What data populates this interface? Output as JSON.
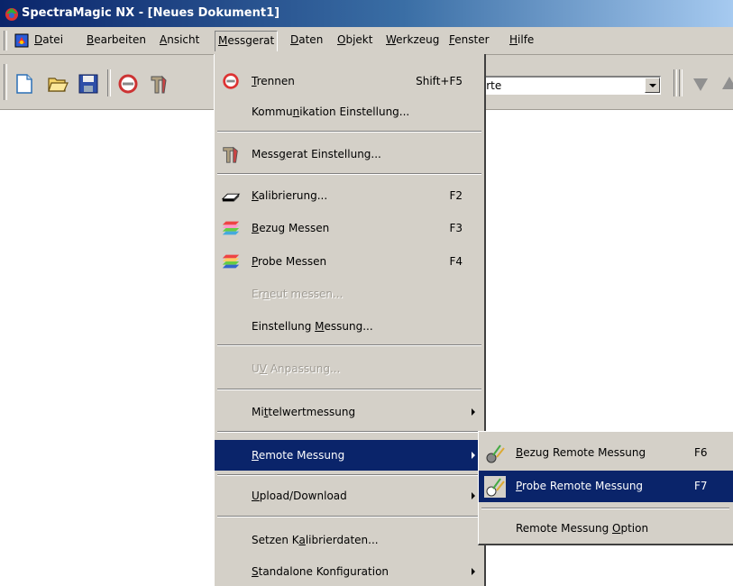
{
  "window": {
    "title": "SpectraMagic NX - [Neues Dokument1]"
  },
  "menubar": {
    "items": [
      {
        "pre": "",
        "key": "D",
        "post": "atei"
      },
      {
        "pre": "",
        "key": "B",
        "post": "earbeiten"
      },
      {
        "pre": "",
        "key": "A",
        "post": "nsicht"
      },
      {
        "pre": "",
        "key": "M",
        "post": "essgerat"
      },
      {
        "pre": "",
        "key": "D",
        "post": "aten"
      },
      {
        "pre": "",
        "key": "O",
        "post": "bjekt"
      },
      {
        "pre": "",
        "key": "W",
        "post": "erkzeug"
      },
      {
        "pre": "",
        "key": "F",
        "post": "enster"
      },
      {
        "pre": "",
        "key": "H",
        "post": "ilfe"
      }
    ]
  },
  "toolbar": {
    "combo_value": "werte",
    "icons": [
      "new-document-icon",
      "open-folder-icon",
      "save-disk-icon",
      "disconnect-icon",
      "instrument-settings-icon"
    ]
  },
  "messgerat_menu": {
    "items": [
      {
        "pre": "",
        "key": "T",
        "post": "rennen",
        "shortcut": "Shift+F5",
        "icon": "disconnect-icon",
        "enabled": true
      },
      {
        "pre": "Kommu",
        "key": "n",
        "post": "ikation Einstellung...",
        "shortcut": "",
        "enabled": true
      },
      {
        "pre": "Mess",
        "key": "g",
        "post": "erat Einstellung...",
        "shortcut": "",
        "icon": "instrument-settings-icon",
        "enabled": true
      },
      {
        "pre": "",
        "key": "K",
        "post": "alibrierung...",
        "shortcut": "F2",
        "icon": "calibration-plate-icon",
        "enabled": true
      },
      {
        "pre": "",
        "key": "B",
        "post": "ezug Messen",
        "shortcut": "F3",
        "icon": "target-measure-icon",
        "enabled": true
      },
      {
        "pre": "",
        "key": "P",
        "post": "robe Messen",
        "shortcut": "F4",
        "icon": "sample-measure-icon",
        "enabled": true
      },
      {
        "pre": "Er",
        "key": "n",
        "post": "eut messen...",
        "shortcut": "",
        "enabled": false
      },
      {
        "pre": "Einstellung ",
        "key": "M",
        "post": "essung...",
        "shortcut": "",
        "enabled": true
      },
      {
        "pre": "U",
        "key": "V",
        "post": " Anpassung...",
        "shortcut": "",
        "enabled": false
      },
      {
        "pre": "Mi",
        "key": "t",
        "post": "telwertmessung",
        "shortcut": "",
        "submenu": true,
        "enabled": true
      },
      {
        "pre": "",
        "key": "R",
        "post": "emote Messung",
        "shortcut": "",
        "submenu": true,
        "enabled": true
      },
      {
        "pre": "",
        "key": "U",
        "post": "pload/Download",
        "shortcut": "",
        "submenu": true,
        "enabled": true
      },
      {
        "pre": "Setzen K",
        "key": "a",
        "post": "librierdaten...",
        "shortcut": "",
        "enabled": true
      },
      {
        "pre": "",
        "key": "S",
        "post": "tandalone Konfiguration",
        "shortcut": "",
        "submenu": true,
        "enabled": true
      }
    ]
  },
  "remote_submenu": {
    "items": [
      {
        "pre": "",
        "key": "B",
        "post": "ezug Remote Messung",
        "shortcut": "F6",
        "icon": "remote-target-icon"
      },
      {
        "pre": "",
        "key": "P",
        "post": "robe Remote Messung",
        "shortcut": "F7",
        "icon": "remote-sample-icon"
      },
      {
        "pre": "Remote Messung ",
        "key": "O",
        "post": "ption",
        "shortcut": ""
      }
    ]
  },
  "colors": {
    "title_gradient_start": "#0a246a",
    "title_gradient_end": "#a6caf0",
    "menu_face": "#d4d0c8",
    "highlight": "#0a246a"
  }
}
